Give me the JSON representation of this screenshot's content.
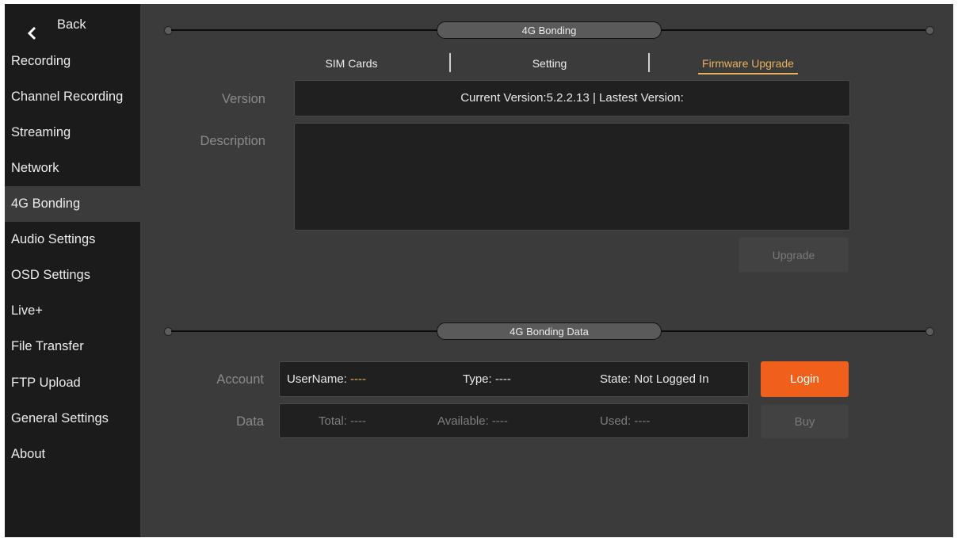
{
  "sidebar": {
    "back_label": "Back",
    "items": [
      {
        "label": "Recording"
      },
      {
        "label": "Channel Recording"
      },
      {
        "label": "Streaming"
      },
      {
        "label": "Network"
      },
      {
        "label": "4G Bonding"
      },
      {
        "label": "Audio Settings"
      },
      {
        "label": "OSD Settings"
      },
      {
        "label": "Live+"
      },
      {
        "label": "File Transfer"
      },
      {
        "label": "FTP Upload"
      },
      {
        "label": "General Settings"
      },
      {
        "label": "About"
      }
    ],
    "active_item": "4G Bonding"
  },
  "section_bonding": {
    "title": "4G Bonding",
    "tabs": [
      {
        "label": "SIM Cards"
      },
      {
        "label": "Setting"
      },
      {
        "label": "Firmware Upgrade"
      }
    ],
    "active_tab": "Firmware Upgrade",
    "version_label": "Version",
    "version_value": "Current Version:5.2.2.13 | Lastest Version:",
    "description_label": "Description",
    "description_value": "",
    "upgrade_label": "Upgrade"
  },
  "section_data": {
    "title": "4G Bonding Data",
    "account_label": "Account",
    "username_label": "UserName:",
    "username_value": "----",
    "type_text": "Type: ----",
    "state_text": "State: Not Logged In",
    "login_label": "Login",
    "data_label": "Data",
    "total_text": "Total: ----",
    "available_text": "Available: ----",
    "used_text": "Used: ----",
    "buy_label": "Buy"
  },
  "colors": {
    "accent": "#e7b25e",
    "login_button": "#f0601a",
    "sidebar_bg": "#1b1b1b",
    "content_bg": "#3b3b3b"
  }
}
